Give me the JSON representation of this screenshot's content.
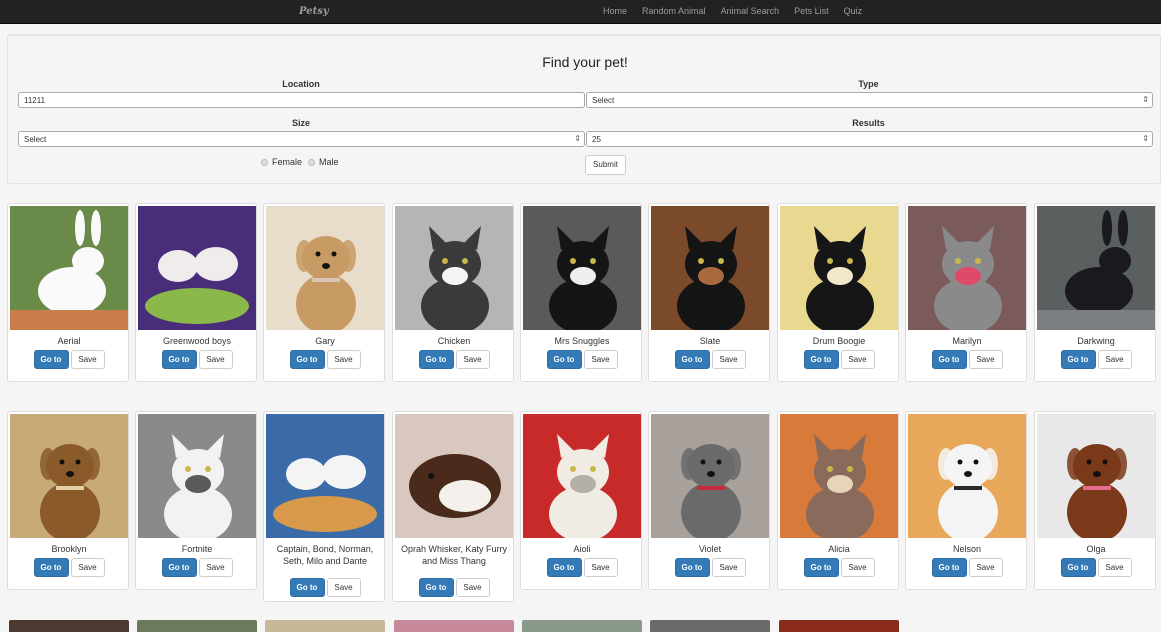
{
  "navbar": {
    "brand": "Petsy",
    "links": [
      "Home",
      "Random Animal",
      "Animal Search",
      "Pets List",
      "Quiz"
    ]
  },
  "search": {
    "title": "Find your pet!",
    "location_label": "Location",
    "location_value": "11211",
    "type_label": "Type",
    "type_value": "Select",
    "size_label": "Size",
    "size_value": "Select",
    "results_label": "Results",
    "results_value": "25",
    "female_label": "Female",
    "male_label": "Male",
    "submit_label": "Submit"
  },
  "buttons": {
    "go": "Go to",
    "save": "Save"
  },
  "pets_row1": [
    {
      "name": "Aerial",
      "icon": "rabbit-photo",
      "colors": [
        "#6a8a4a",
        "#fafafa",
        "#c87d4a"
      ]
    },
    {
      "name": "Greenwood boys",
      "icon": "rats-photo",
      "colors": [
        "#4a2d7a",
        "#f0ecec",
        "#8ab84a"
      ]
    },
    {
      "name": "Gary",
      "icon": "dog-photo",
      "colors": [
        "#e8dccb",
        "#c89a64",
        "#d7c7b2"
      ]
    },
    {
      "name": "Chicken",
      "icon": "cat-photo",
      "colors": [
        "#b5b5b5",
        "#3a3a3a",
        "#f4f4f4"
      ]
    },
    {
      "name": "Mrs Snuggles",
      "icon": "cat-photo",
      "colors": [
        "#5a5a5a",
        "#151515",
        "#efefef"
      ]
    },
    {
      "name": "Slate",
      "icon": "cat-photo",
      "colors": [
        "#7a4a2a",
        "#141414",
        "#a86a3e"
      ]
    },
    {
      "name": "Drum Boogie",
      "icon": "cat-photo",
      "colors": [
        "#e8d890",
        "#161616",
        "#f0e8c8"
      ]
    },
    {
      "name": "Marilyn",
      "icon": "cat-photo",
      "colors": [
        "#7a5a5a",
        "#8a8a8a",
        "#e04a6a"
      ]
    },
    {
      "name": "Darkwing",
      "icon": "rabbit-photo",
      "colors": [
        "#5a5f60",
        "#1a1a1e",
        "#7a7e80"
      ]
    }
  ],
  "pets_row2": [
    {
      "name": "Brooklyn",
      "icon": "dog-photo",
      "colors": [
        "#c8a978",
        "#8a5a2a",
        "#e4cfa8"
      ]
    },
    {
      "name": "Fortnite",
      "icon": "cat-photo",
      "colors": [
        "#8a8a8a",
        "#f2f2f2",
        "#5a5a5a"
      ]
    },
    {
      "name": "Captain, Bond, Norman, Seth, Milo and Dante",
      "icon": "rats-photo",
      "colors": [
        "#3a6aa8",
        "#f4f4f4",
        "#d89a4a"
      ]
    },
    {
      "name": "Oprah Whisker, Katy Furry and Miss Thang",
      "icon": "guinea-pig-photo",
      "colors": [
        "#d8c8c0",
        "#4a2a1a",
        "#f4f0ec"
      ]
    },
    {
      "name": "Aioli",
      "icon": "cat-photo",
      "colors": [
        "#c82a2a",
        "#f0ece4",
        "#b4b0a8"
      ]
    },
    {
      "name": "Violet",
      "icon": "dog-photo",
      "colors": [
        "#a8a09a",
        "#6a6a6a",
        "#c82a3a"
      ]
    },
    {
      "name": "Alicia",
      "icon": "cat-photo",
      "colors": [
        "#d87a3a",
        "#8a6a5a",
        "#e8d4b8"
      ]
    },
    {
      "name": "Nelson",
      "icon": "dog-photo",
      "colors": [
        "#e8a85a",
        "#f4f4f4",
        "#2a2a2a"
      ]
    },
    {
      "name": "Olga",
      "icon": "dog-photo",
      "colors": [
        "#e8e8e8",
        "#7a3a1a",
        "#e86a8a"
      ]
    }
  ],
  "pets_row3_colors": [
    "#4a3a30",
    "#6a7a5a",
    "#c8b89a",
    "#c88a9a",
    "#8a9a8a",
    "#6a6a6a",
    "#8a2a1a"
  ]
}
